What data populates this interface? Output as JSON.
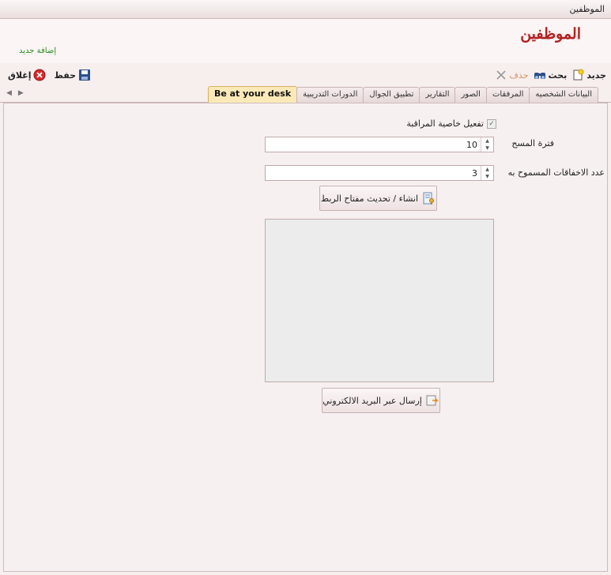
{
  "window": {
    "title": "الموظفين"
  },
  "header": {
    "title": "الموظفين",
    "add_new": "إضافة جديد"
  },
  "toolbar": {
    "new_label": "جديد",
    "search_label": "بحث",
    "delete_label": "حذف",
    "save_label": "حفظ",
    "close_label": "إغلاق"
  },
  "tabs": [
    {
      "label": "البيانات الشخصيه",
      "active": false
    },
    {
      "label": "المرفقات",
      "active": false
    },
    {
      "label": "الصور",
      "active": false
    },
    {
      "label": "التقارير",
      "active": false
    },
    {
      "label": "تطبيق الجوال",
      "active": false
    },
    {
      "label": "الدورات التدريبية",
      "active": false
    },
    {
      "label": "Be at your desk",
      "active": true
    }
  ],
  "form": {
    "monitor_checkbox_label": "تفعيل خاصية المراقبة",
    "monitor_checked": true,
    "scan_period_label": "فترة المسح",
    "scan_period_value": "10",
    "failures_label": "عدد الاخفاقات المسموح به",
    "failures_value": "3",
    "generate_key_button": "انشاء / تحديث مفتاح الربط",
    "send_email_button": "إرسال عبر البريد الالكتروني"
  },
  "colors": {
    "accent": "#b02222",
    "active_tab": "#fbe9b8",
    "link_green": "#2a8a1e"
  }
}
